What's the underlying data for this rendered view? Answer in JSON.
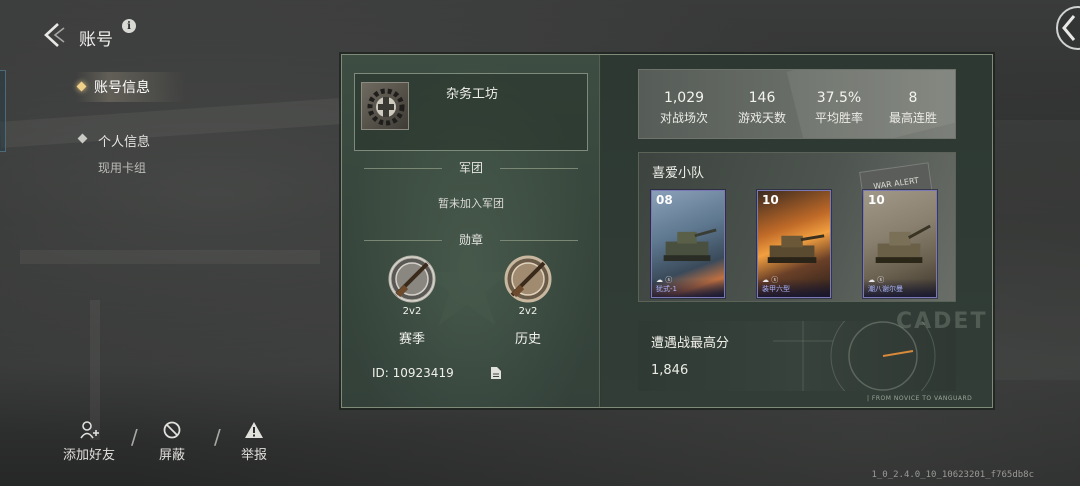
{
  "header": {
    "title": "账号",
    "info_label": "i"
  },
  "nav": {
    "active": "账号信息",
    "personal": "个人信息",
    "current_deck": "现用卡组"
  },
  "actions": {
    "add_friend": "添加好友",
    "block": "屏蔽",
    "report": "举报",
    "separator": "/"
  },
  "version": "1_0_2.4.0_10_10623201_f765db8c",
  "profile": {
    "nickname": "杂务工坊",
    "legion_title": "军团",
    "legion_status": "暂未加入军团",
    "medals_title": "勋章",
    "medals": [
      {
        "tag": "2v2",
        "label": "赛季"
      },
      {
        "tag": "2v2",
        "label": "历史"
      }
    ],
    "id_text": "ID: 10923419"
  },
  "stats": [
    {
      "value": "1,029",
      "label": "对战场次"
    },
    {
      "value": "146",
      "label": "游戏天数"
    },
    {
      "value": "37.5%",
      "label": "平均胜率"
    },
    {
      "value": "8",
      "label": "最高连胜"
    }
  ],
  "squad": {
    "title": "喜爱小队",
    "badge_text": "WAR ALERT",
    "units": [
      {
        "level": "08",
        "name": "犹式-1"
      },
      {
        "level": "10",
        "name": "装甲六型"
      },
      {
        "level": "10",
        "name": "潮八谢尔曼"
      }
    ]
  },
  "encounter": {
    "title": "遭遇战最高分",
    "score": "1,846"
  },
  "decor": {
    "cadet": "CADET",
    "novice": "| FROM NOVICE TO VANGUARD"
  },
  "colors": {
    "card_border": "#7f8a78",
    "unit_name": "#a8b4ff",
    "accent_gold": "#e8c27a"
  }
}
